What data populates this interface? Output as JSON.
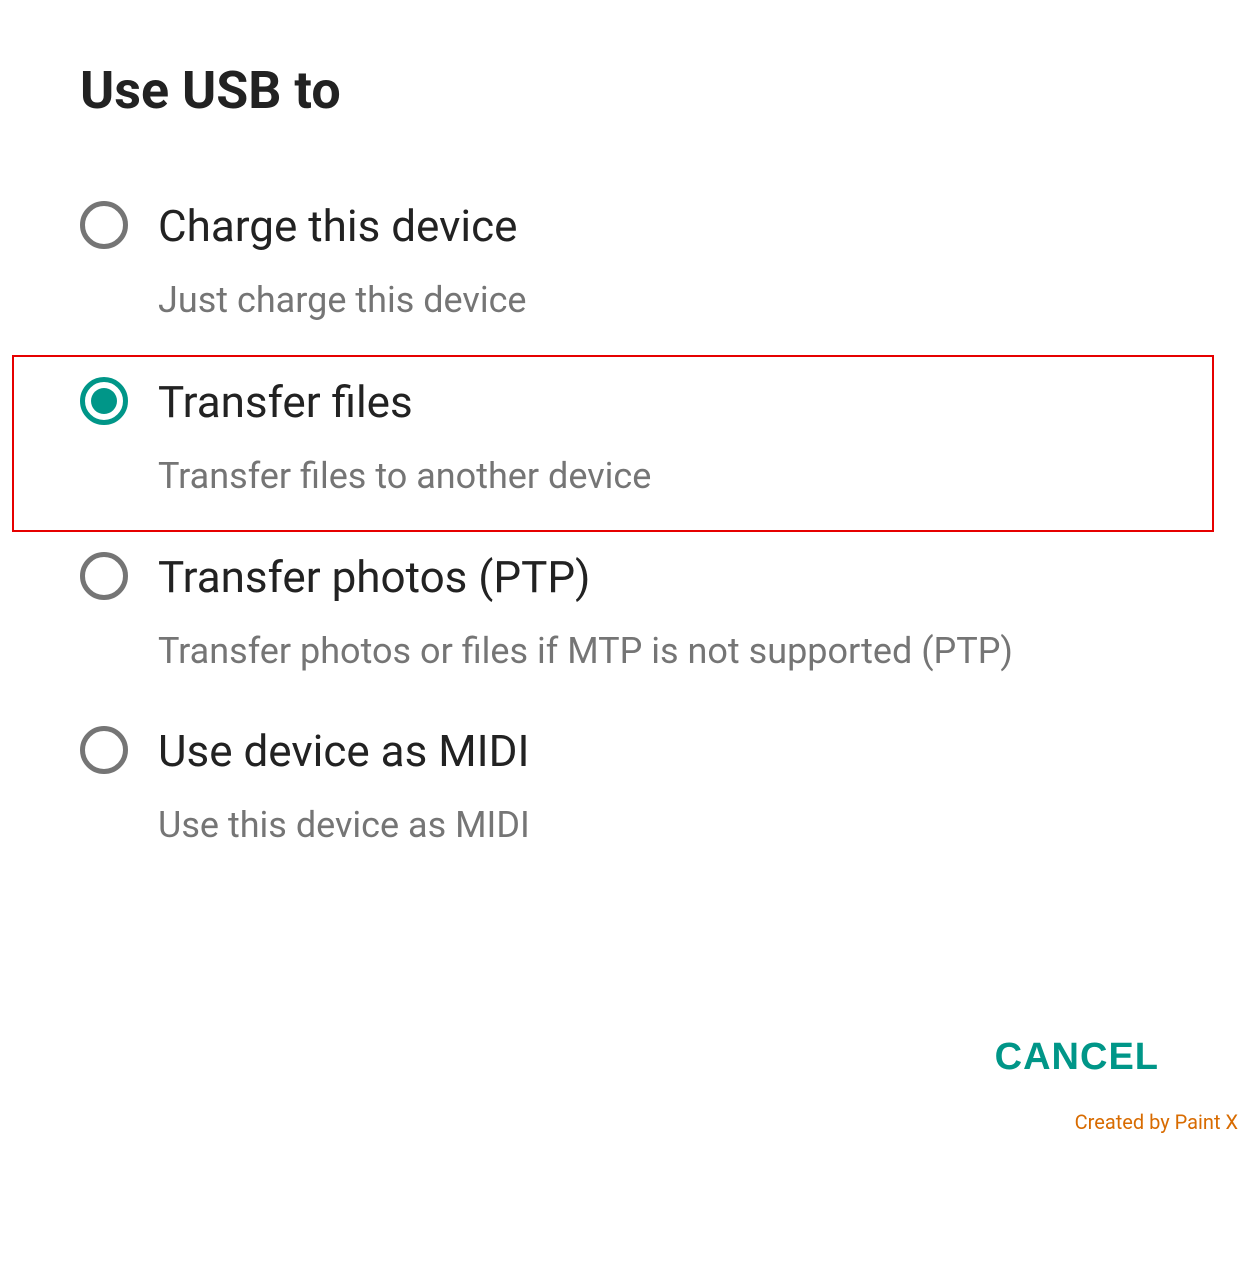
{
  "dialog": {
    "title": "Use USB to",
    "options": [
      {
        "label": "Charge this device",
        "description": "Just charge this device",
        "selected": false,
        "highlighted": false
      },
      {
        "label": "Transfer files",
        "description": "Transfer files to another device",
        "selected": true,
        "highlighted": true
      },
      {
        "label": "Transfer photos (PTP)",
        "description": "Transfer photos or files if MTP is not supported (PTP)",
        "selected": false,
        "highlighted": false
      },
      {
        "label": "Use device as MIDI",
        "description": "Use this device as MIDI",
        "selected": false,
        "highlighted": false
      }
    ],
    "cancel_label": "CANCEL"
  },
  "watermark": "Created by Paint X",
  "colors": {
    "accent": "#009688",
    "highlight_border": "#e60000",
    "text_primary": "#222222",
    "text_secondary": "#757575"
  }
}
